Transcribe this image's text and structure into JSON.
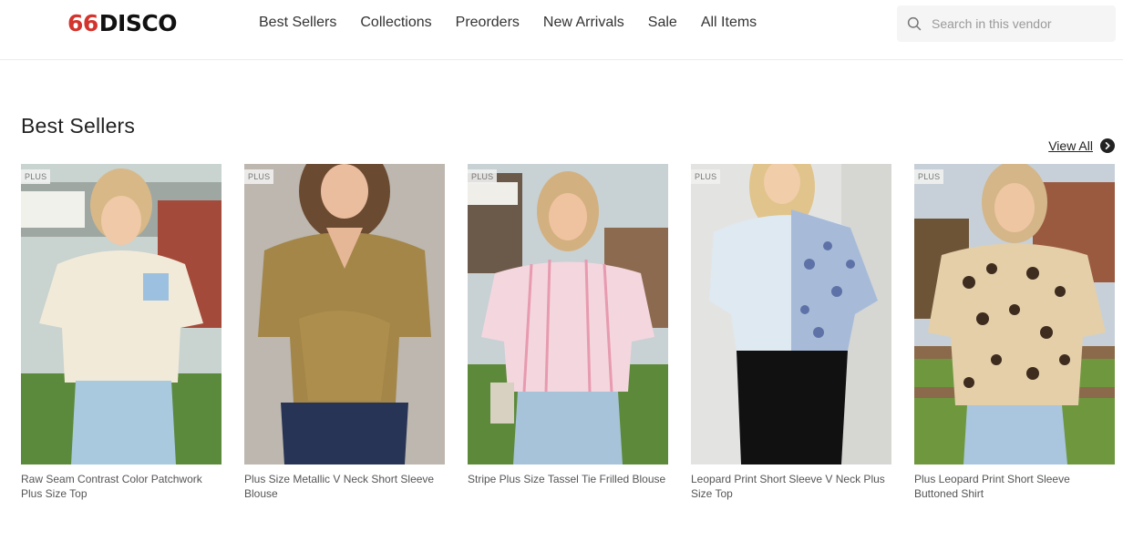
{
  "header": {
    "logo_number": "66",
    "logo_word": "DISCO",
    "nav": [
      "Best Sellers",
      "Collections",
      "Preorders",
      "New Arrivals",
      "Sale",
      "All Items"
    ],
    "search_placeholder": "Search in this vendor"
  },
  "section": {
    "title": "Best Sellers",
    "view_all": "View All"
  },
  "products": [
    {
      "badge": "PLUS",
      "title": "Raw Seam Contrast Color Patchwork Plus Size Top"
    },
    {
      "badge": "PLUS",
      "title": "Plus Size Metallic V Neck Short Sleeve Blouse"
    },
    {
      "badge": "PLUS",
      "title": "Stripe Plus Size Tassel Tie Frilled Blouse"
    },
    {
      "badge": "PLUS",
      "title": "Leopard Print Short Sleeve V Neck Plus Size Top"
    },
    {
      "badge": "PLUS",
      "title": "Plus Leopard Print Short Sleeve Buttoned Shirt"
    }
  ],
  "icons": {
    "search": "search-icon",
    "view_all_arrow": "chevron-right-circle-icon"
  }
}
